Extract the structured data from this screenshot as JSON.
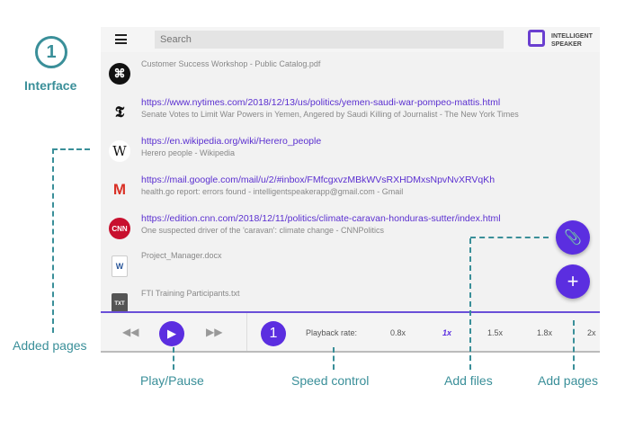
{
  "annotation": {
    "step": "1",
    "title": "Interface",
    "labels": {
      "added_pages": "Added pages",
      "play_pause": "Play/Pause",
      "speed_control": "Speed control",
      "add_files": "Add files",
      "add_pages": "Add pages"
    }
  },
  "header": {
    "search_placeholder": "Search",
    "logo_line1": "INTELLIGENT",
    "logo_line2": "SPEAKER"
  },
  "items": [
    {
      "icon": "pdf-icon",
      "url": "",
      "title": "Customer Success Workshop - Public Catalog.pdf"
    },
    {
      "icon": "nytimes-icon",
      "glyph": "𝕿",
      "url": "https://www.nytimes.com/2018/12/13/us/politics/yemen-saudi-war-pompeo-mattis.html",
      "title": "Senate Votes to Limit War Powers in Yemen, Angered by Saudi Killing of Journalist - The New York Times"
    },
    {
      "icon": "wikipedia-icon",
      "glyph": "W",
      "url": "https://en.wikipedia.org/wiki/Herero_people",
      "title": "Herero people - Wikipedia"
    },
    {
      "icon": "gmail-icon",
      "glyph": "M",
      "url": "https://mail.google.com/mail/u/2/#inbox/FMfcgxvzMBkWVsRXHDMxsNpvNvXRVqKh",
      "title": "health.go report: errors found - intelligentspeakerapp@gmail.com - Gmail"
    },
    {
      "icon": "cnn-icon",
      "glyph": "CNN",
      "url": "https://edition.cnn.com/2018/12/11/politics/climate-caravan-honduras-sutter/index.html",
      "title": "One suspected driver of the 'caravan': climate change - CNNPolitics"
    },
    {
      "icon": "word-doc-icon",
      "glyph": "W",
      "url": "",
      "title": "Project_Manager.docx"
    },
    {
      "icon": "txt-file-icon",
      "glyph": "TXT",
      "url": "",
      "title": "FTI Training Participants.txt"
    }
  ],
  "player": {
    "speed_badge": "1",
    "playback_label": "Playback rate:",
    "rates": [
      "0.8x",
      "1x",
      "1.5x",
      "1.8x",
      "2x"
    ],
    "selected_rate": "1x"
  }
}
